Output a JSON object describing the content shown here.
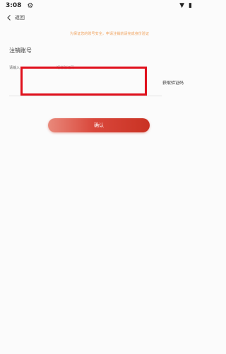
{
  "status_bar": {
    "time": "3:08",
    "settings_glyph": "⚙",
    "wifi_glyph": "▼",
    "battery_glyph": "▮"
  },
  "nav": {
    "back_label": "返回"
  },
  "notice": {
    "text": "为保证您的账号安全，申请注销前请完成身份验证",
    "color": "#f0a05a"
  },
  "form": {
    "title": "注销账号",
    "code_label": "请输入",
    "code_placeholder": "短信验证码",
    "code_value": "",
    "get_code_label": "获取验证码"
  },
  "confirm": {
    "label": "确认",
    "color": "#d9473b"
  },
  "icons": {
    "back": "chevron-left-icon",
    "settings": "gear-icon",
    "wifi": "wifi-icon",
    "battery": "battery-icon"
  }
}
